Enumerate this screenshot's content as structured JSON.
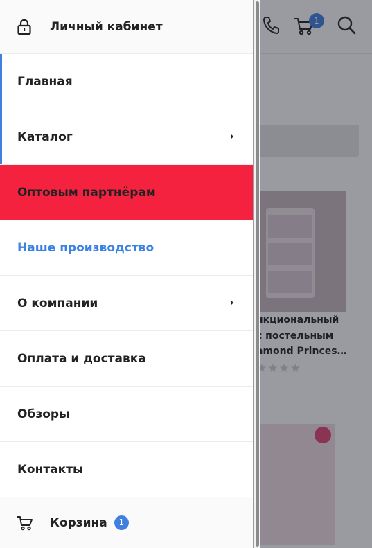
{
  "drawer": {
    "account_label": "Личный кабинет",
    "menu": [
      {
        "label": "Главная"
      },
      {
        "label": "Каталог"
      },
      {
        "label": "Оптовым партнёрам"
      },
      {
        "label": "Наше производство"
      },
      {
        "label": "О компании"
      },
      {
        "label": "Оплата и доставка"
      },
      {
        "label": "Обзоры"
      },
      {
        "label": "Контакты"
      }
    ],
    "cart_label": "Корзина",
    "cart_count": "1"
  },
  "background": {
    "cart_count": "1",
    "product_title_lines": [
      "нкциональный",
      "с постельным",
      "amond Princes…"
    ],
    "rating_stars": "★★★★"
  },
  "colors": {
    "accent_blue": "#3f7fe0",
    "highlight_red": "#f5223f",
    "link_blue": "#3a82e4"
  }
}
